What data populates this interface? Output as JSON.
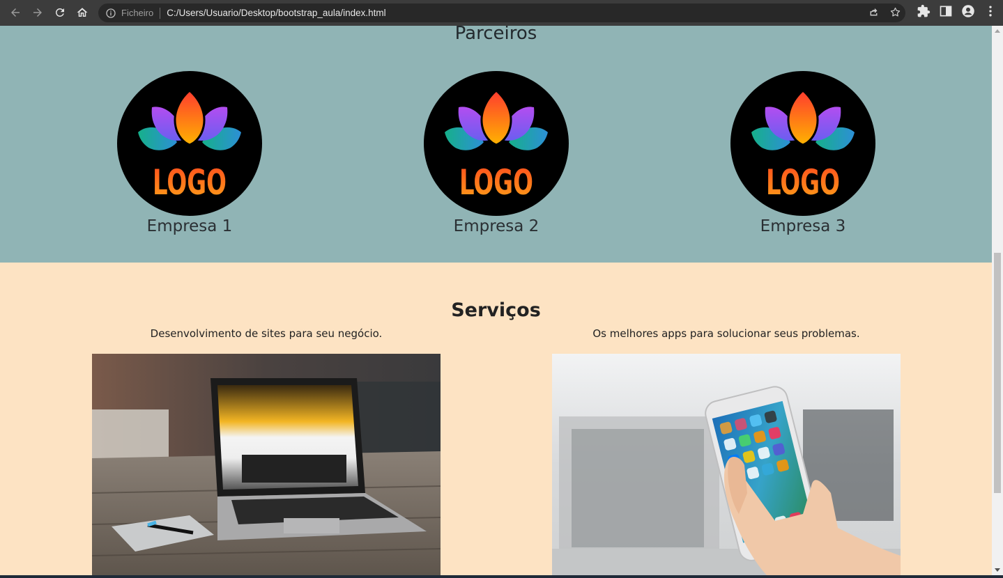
{
  "browser": {
    "scheme_label": "Ficheiro",
    "url": "C:/Users/Usuario/Desktop/bootstrap_aula/index.html"
  },
  "partners": {
    "title": "Parceiros",
    "logo_text": "LOGO",
    "items": [
      {
        "name": "Empresa 1"
      },
      {
        "name": "Empresa 2"
      },
      {
        "name": "Empresa 3"
      }
    ]
  },
  "services": {
    "title": "Serviços",
    "items": [
      {
        "description": "Desenvolvimento de sites para seu negócio.",
        "image": "laptop-on-desk-photo"
      },
      {
        "description": "Os melhores apps para solucionar seus problemas.",
        "image": "hand-holding-phone-photo"
      }
    ]
  },
  "colors": {
    "partners_bg": "#90b4b5",
    "services_bg": "#fde3c3",
    "chrome_bg": "#3c3c3c"
  }
}
